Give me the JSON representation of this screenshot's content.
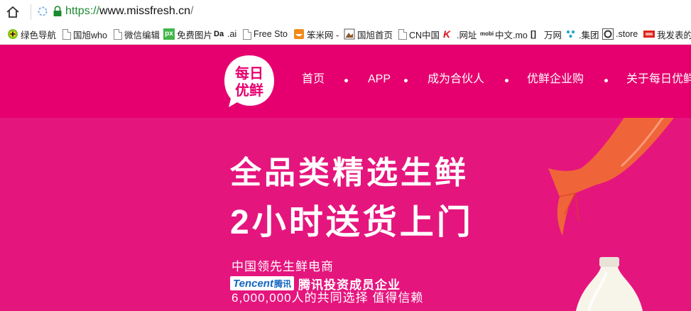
{
  "browser": {
    "url_scheme": "https://",
    "url_host": "www.missfresh.cn",
    "url_rest": "/"
  },
  "bookmarks": [
    {
      "label": "绿色导航",
      "icon": "green-plus-icon"
    },
    {
      "label": "国旭who",
      "icon": "page-icon"
    },
    {
      "label": "微信编辑",
      "icon": "page-icon"
    },
    {
      "label": "免费图片",
      "icon": "px-icon"
    },
    {
      "label": ".ai",
      "icon": "da-icon"
    },
    {
      "label": "Free Sto",
      "icon": "page-icon"
    },
    {
      "label": "笨米网 -",
      "icon": "orange-bowl-icon"
    },
    {
      "label": "国旭首页",
      "icon": "image-icon"
    },
    {
      "label": "CN中国",
      "icon": "page-icon"
    },
    {
      "label": ".网址",
      "icon": "k-icon"
    },
    {
      "label": "中文.mo",
      "icon": "mobi-icon"
    },
    {
      "label": "万网",
      "icon": "cc-icon"
    },
    {
      "label": ".集团",
      "icon": "dots-icon"
    },
    {
      "label": ".store",
      "icon": "ring-icon"
    },
    {
      "label": "我发表的",
      "icon": "red-tag-icon"
    }
  ],
  "site": {
    "logo_line1": "每日",
    "logo_line2": "优鲜",
    "nav": [
      "首页",
      "APP",
      "成为合伙人",
      "优鲜企业购",
      "关于每日优鲜"
    ]
  },
  "hero": {
    "headline1": "全品类精选生鲜",
    "headline2": "2小时送货上门",
    "sub1": "中国领先生鲜电商",
    "tencent_en": "Tencent",
    "tencent_cn": "腾讯",
    "tencent_text": "腾讯投资成员企业",
    "sub3": "6,000,000人的共同选择  值得信赖"
  },
  "colors": {
    "brand_pink": "#e6006f",
    "hero_pink": "#e5157e",
    "secure_green": "#1b8a2f"
  }
}
